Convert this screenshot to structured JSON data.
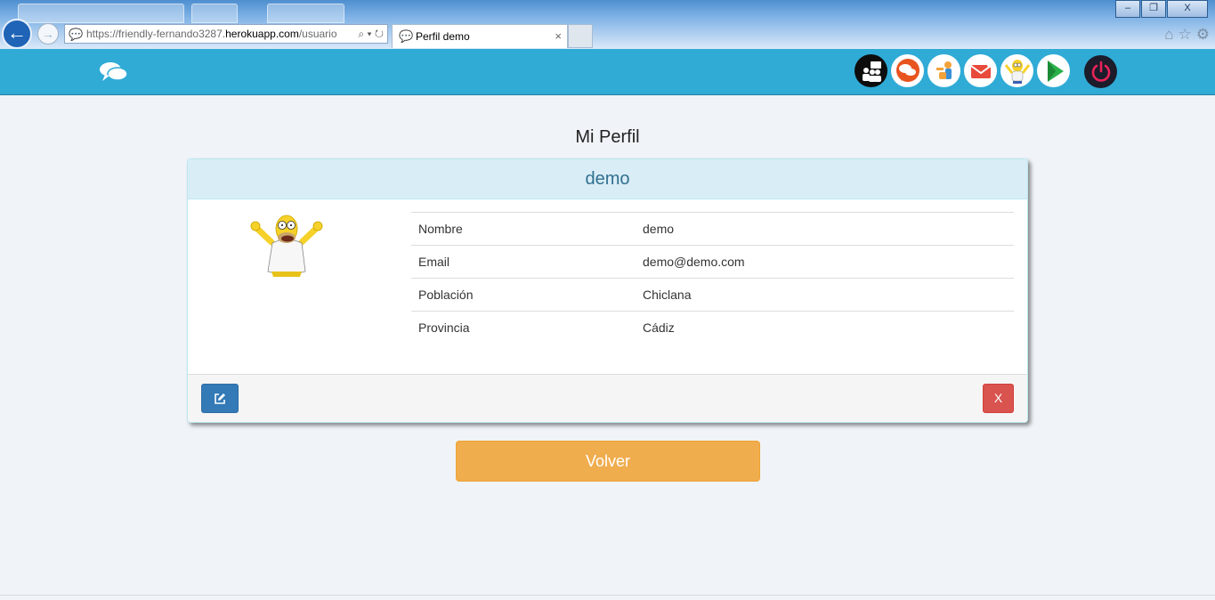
{
  "browser": {
    "address_scheme": "https://friendly-fernando3287.",
    "address_host": "herokuapp.com",
    "address_path": "/usuario",
    "active_tab_title": "Perfil demo",
    "window_buttons": [
      "–",
      "❐",
      "X"
    ]
  },
  "header": {
    "nav_icons": [
      "users-icon",
      "chat-icon",
      "friends-icon",
      "mail-icon",
      "profile-homer-icon",
      "play-icon"
    ],
    "power_icon": "power-icon",
    "colors": {
      "bar": "#2fabd6"
    }
  },
  "page": {
    "title": "Mi Perfil"
  },
  "profile": {
    "username": "demo",
    "fields": [
      {
        "label": "Nombre",
        "value": "demo"
      },
      {
        "label": "Email",
        "value": "demo@demo.com"
      },
      {
        "label": "Población",
        "value": "Chiclana"
      },
      {
        "label": "Provincia",
        "value": "Cádiz"
      }
    ],
    "delete_label": "X"
  },
  "actions": {
    "back_label": "Volver"
  }
}
